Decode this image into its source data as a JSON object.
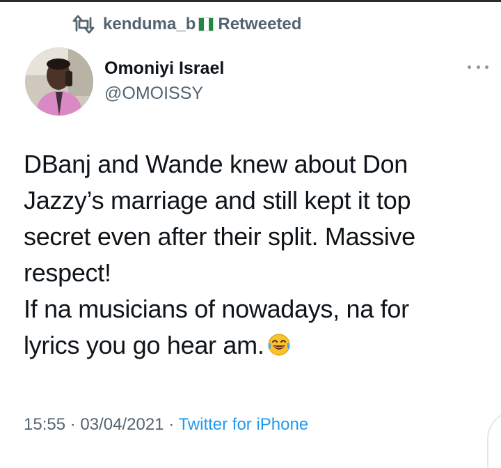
{
  "retweet": {
    "icon": "retweet-icon",
    "user": "kenduma_b",
    "flag": "nigeria-flag",
    "label": "Retweeted"
  },
  "author": {
    "name": "Omoniyi Israel",
    "handle": "@OMOISSY"
  },
  "tweet": {
    "lines": [
      "DBanj and Wande knew about Don",
      "Jazzy’s marriage and still kept it top",
      "secret even after their split. Massive",
      "respect!",
      "If na musicians of nowadays, na for",
      "lyrics you go hear am."
    ],
    "emoji": "face-with-tears-of-joy"
  },
  "meta": {
    "time": "15:55",
    "date": "03/04/2021",
    "separator": "·",
    "source": "Twitter for iPhone"
  },
  "colors": {
    "secondary_text": "#536471",
    "link": "#1d9bf0",
    "primary_text": "#0f1419"
  }
}
